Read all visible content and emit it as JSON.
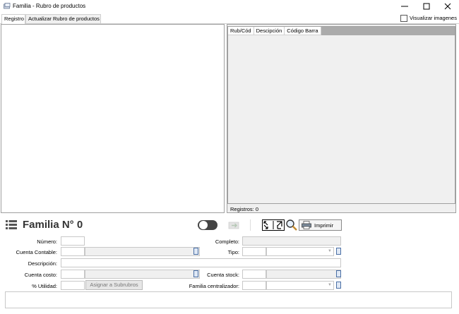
{
  "window": {
    "title": "Familia - Rubro de productos",
    "minimize_icon": "minimize-icon",
    "maximize_icon": "maximize-icon",
    "close_icon": "close-icon"
  },
  "tabs": [
    {
      "label": "Registro",
      "active": true
    },
    {
      "label": "Actualizar Rubro de productos",
      "active": false
    }
  ],
  "visualizar": {
    "label": "Visualizar imagenes",
    "checked": false
  },
  "grid": {
    "columns": [
      "Rub/Cód",
      "Descipción",
      "Código Barra"
    ],
    "rows": [],
    "registros_label": "Registros: 0"
  },
  "header": {
    "title": "Familia N° 0",
    "list_icon": "list-icon",
    "toggle_on": false,
    "print_label": "Imprimir"
  },
  "form": {
    "numero_label": "Número:",
    "cuenta_contable_label": "Cuenta Contable:",
    "descripcion_label": "Descripción:",
    "cuenta_costo_label": "Cuenta costo:",
    "utilidad_label": "% Utilidad:",
    "completo_label": "Completo:",
    "tipo_label": "Tipo:",
    "cuenta_stock_label": "Cuenta stock:",
    "familia_centralizador_label": "Familia centralizador:",
    "asignar_label": "Asignar a Subrubros"
  },
  "colors": {
    "grid_background": "#ababab",
    "panel_background": "#f0f0f0",
    "accent_lookup": "#4a6fa5"
  }
}
